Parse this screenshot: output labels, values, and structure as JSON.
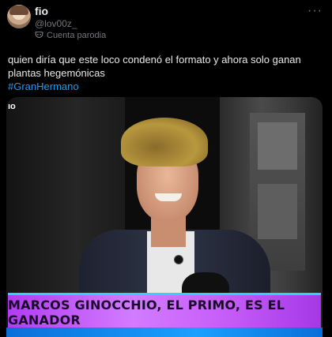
{
  "user": {
    "display_name": "fio",
    "handle": "@lov00z_",
    "parody_label": "Cuenta parodia"
  },
  "menu": {
    "more_label": "···"
  },
  "tweet": {
    "text": "quien diría que este loco condenó el formato y ahora solo ganan plantas hegemónicas",
    "hashtag": "#GranHermano"
  },
  "media": {
    "watermark": "ıo",
    "caption": "MARCOS GINOCCHIO, EL PRIMO, ES EL GANADOR"
  },
  "colors": {
    "background": "#000000",
    "text": "#e7e9ea",
    "secondary_text": "#71767b",
    "link": "#1d9bf0",
    "banner": "#c65cf8"
  },
  "icons": {
    "parody": "mask-icon",
    "more": "more-icon"
  }
}
